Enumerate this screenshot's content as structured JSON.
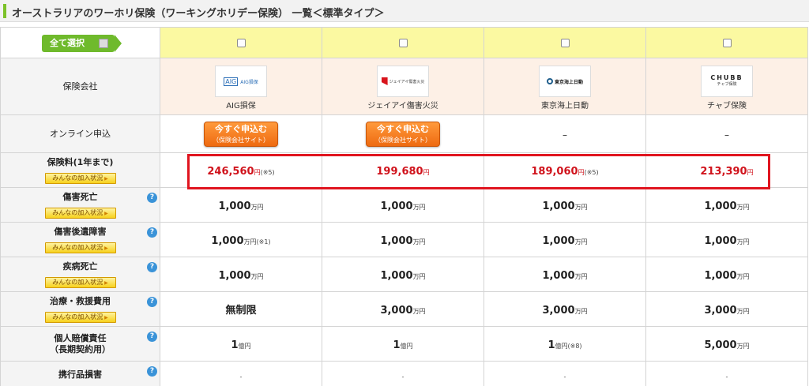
{
  "title": "オーストラリアのワーホリ保険（ワーキングホリデー保険） 一覧＜標準タイプ＞",
  "select_all_label": "全て選択",
  "colors": {
    "accent": "#6fba2c",
    "premium": "#d0121b",
    "highlight": "#e0151f"
  },
  "rows": {
    "company_label": "保険会社",
    "online_label": "オンライン申込",
    "premium_label": "保険料(1年まで)",
    "badge_label": "みんなの加入状況",
    "injury_death_label": "傷害死亡",
    "injury_disability_label": "傷害後遺障害",
    "illness_death_label": "疾病死亡",
    "treatment_label": "治療・救援費用",
    "liability_label_1": "個人賠償責任",
    "liability_label_2": "（長期契約用）",
    "belongings_label": "携行品損害"
  },
  "apply_button": {
    "line1": "今すぐ申込む",
    "line2": "（保険会社サイト）"
  },
  "companies": [
    {
      "name": "AIG損保",
      "logo": {
        "brand": "AIG",
        "text": "AIG損保"
      },
      "online": "button",
      "premium": "246,560",
      "premium_unit": "円",
      "premium_note": "(※5)",
      "injury_death": "1,000",
      "injury_death_unit": "万円",
      "injury_disability": "1,000",
      "injury_disability_unit": "万円",
      "injury_disability_note": "(※1)",
      "illness_death": "1,000",
      "illness_death_unit": "万円",
      "treatment": "無制限",
      "treatment_unit": "",
      "liability": "1",
      "liability_unit": "億円",
      "liability_note": "",
      "belongings": "-"
    },
    {
      "name": "ジェイアイ傷害火災",
      "logo": {
        "text": "ジェイアイ傷害火災"
      },
      "online": "button",
      "premium": "199,680",
      "premium_unit": "円",
      "premium_note": "",
      "injury_death": "1,000",
      "injury_death_unit": "万円",
      "injury_disability": "1,000",
      "injury_disability_unit": "万円",
      "injury_disability_note": "",
      "illness_death": "1,000",
      "illness_death_unit": "万円",
      "treatment": "3,000",
      "treatment_unit": "万円",
      "liability": "1",
      "liability_unit": "億円",
      "liability_note": "",
      "belongings": "-"
    },
    {
      "name": "東京海上日動",
      "logo": {
        "text": "東京海上日動"
      },
      "online": "–",
      "premium": "189,060",
      "premium_unit": "円",
      "premium_note": "(※5)",
      "injury_death": "1,000",
      "injury_death_unit": "万円",
      "injury_disability": "1,000",
      "injury_disability_unit": "万円",
      "injury_disability_note": "",
      "illness_death": "1,000",
      "illness_death_unit": "万円",
      "treatment": "3,000",
      "treatment_unit": "万円",
      "liability": "1",
      "liability_unit": "億円",
      "liability_note": "(※8)",
      "belongings": "-"
    },
    {
      "name": "チャブ保険",
      "logo": {
        "brand": "CHUBB",
        "text": "チャブ保険"
      },
      "online": "–",
      "premium": "213,390",
      "premium_unit": "円",
      "premium_note": "",
      "injury_death": "1,000",
      "injury_death_unit": "万円",
      "injury_disability": "1,000",
      "injury_disability_unit": "万円",
      "injury_disability_note": "",
      "illness_death": "1,000",
      "illness_death_unit": "万円",
      "treatment": "3,000",
      "treatment_unit": "万円",
      "liability": "5,000",
      "liability_unit": "万円",
      "liability_note": "",
      "belongings": "-"
    }
  ]
}
